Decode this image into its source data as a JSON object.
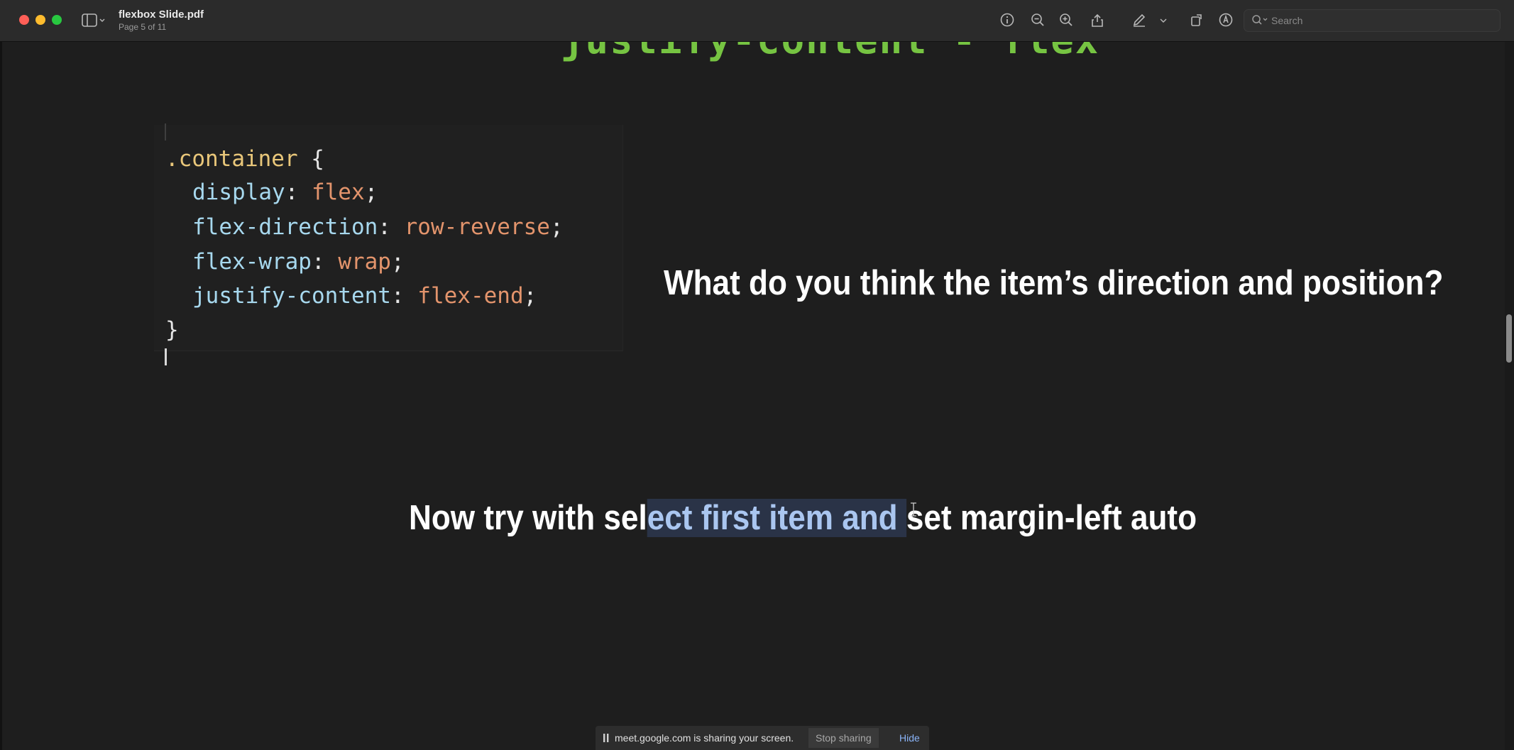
{
  "window": {
    "title": "flexbox Slide.pdf",
    "subtitle": "Page 5 of 11"
  },
  "toolbar": {
    "icons": [
      "sidebar-icon",
      "info-icon",
      "zoom-out-icon",
      "zoom-in-icon",
      "share-icon",
      "markup-pen-icon",
      "chevron-down-icon",
      "rotate-icon",
      "annotate-icon"
    ],
    "search_placeholder": "Search"
  },
  "slide": {
    "title": "justify-content - flex",
    "code": {
      "selector": ".container",
      "open_brace": " {",
      "close_brace": "}",
      "declarations": [
        {
          "property": "display",
          "value": "flex"
        },
        {
          "property": "flex-direction",
          "value": "row-reverse"
        },
        {
          "property": "flex-wrap",
          "value": "wrap"
        },
        {
          "property": "justify-content",
          "value": "flex-end"
        }
      ]
    },
    "question": "What do you think the item’s direction and position?",
    "instruction": {
      "before": "Now try with sel",
      "selected": "ect first item and ",
      "after": "set margin-left auto"
    }
  },
  "colors": {
    "title_green": "#76c442",
    "code_selector": "#e9c77a",
    "code_property": "#a7d8ee",
    "code_value": "#e3946c",
    "selection_text": "#aac6f0"
  },
  "sharing_bar": {
    "message": "meet.google.com is sharing your screen.",
    "stop_label": "Stop sharing",
    "hide_label": "Hide"
  }
}
